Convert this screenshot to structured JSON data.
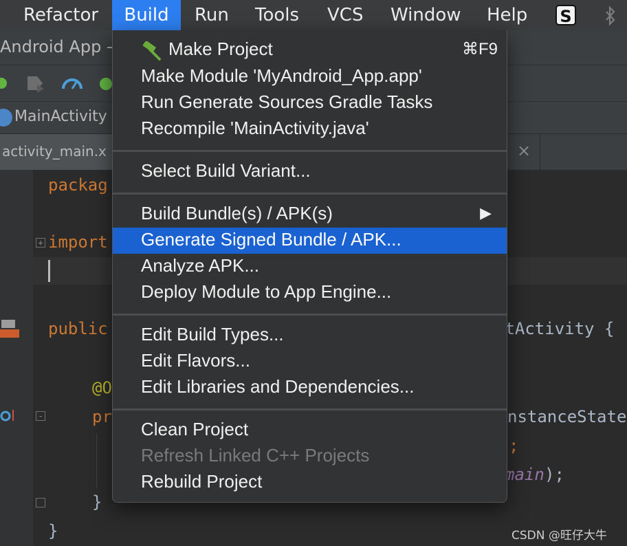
{
  "menubar": {
    "items": [
      "Refactor",
      "Build",
      "Run",
      "Tools",
      "VCS",
      "Window",
      "Help"
    ],
    "active": "Build",
    "status_icons": [
      "s-app-icon",
      "bluetooth-icon"
    ],
    "s_icon_glyph": "S"
  },
  "ide": {
    "title": "Android App –",
    "nav_crumb": "MainActivity",
    "tab": "activity_main.x",
    "tab_close": "×",
    "code": {
      "l1_kw": "packag",
      "l2_kw": "import",
      "l3_kw": "public",
      "l3_rest": "ntActivity {",
      "l4_ann": "@O",
      "l5_kw": "pr",
      "l5_rest": "nstanceState",
      "l6_rest": ";",
      "l7_purple": "main",
      "l7_rest": ");",
      "l8": "}",
      "l9": "}"
    }
  },
  "build_menu": {
    "sections": [
      [
        {
          "label": "Make Project",
          "shortcut": "⌘F9",
          "icon": "hammer-icon"
        },
        {
          "label": "Make Module 'MyAndroid_App.app'"
        },
        {
          "label": "Run Generate Sources Gradle Tasks"
        },
        {
          "label": "Recompile 'MainActivity.java'"
        }
      ],
      [
        {
          "label": "Select Build Variant..."
        }
      ],
      [
        {
          "label": "Build Bundle(s) / APK(s)",
          "submenu_arrow": "▶"
        },
        {
          "label": "Generate Signed Bundle / APK...",
          "highlighted": true
        },
        {
          "label": "Analyze APK..."
        },
        {
          "label": "Deploy Module to App Engine..."
        }
      ],
      [
        {
          "label": "Edit Build Types..."
        },
        {
          "label": "Edit Flavors..."
        },
        {
          "label": "Edit Libraries and Dependencies..."
        }
      ],
      [
        {
          "label": "Clean Project"
        },
        {
          "label": "Refresh Linked C++ Projects",
          "disabled": true
        },
        {
          "label": "Rebuild Project"
        }
      ]
    ]
  },
  "watermark": "CSDN @旺仔大牛",
  "colors": {
    "menubar_bg": "#3a3c3e",
    "active_menu": "#2d7ef0",
    "highlight": "#1a62d1",
    "menu_bg": "#323334",
    "keyword": "#cc7832",
    "annotation": "#bbb529",
    "hammer": "#6aab3c"
  }
}
